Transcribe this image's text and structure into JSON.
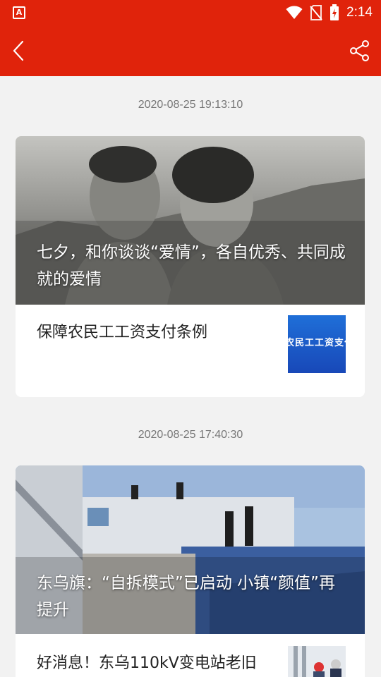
{
  "status_bar": {
    "app_icon": "A",
    "time": "2:14",
    "icons": [
      "wifi-icon",
      "no-sim-icon",
      "battery-charging-icon"
    ]
  },
  "app_bar": {
    "icons": [
      "back-arrow-icon",
      "share-icon"
    ]
  },
  "feed": [
    {
      "timestamp": "2020-08-25 19:13:10",
      "hero_title": "七夕，和你谈谈“爱情”，各自优秀、共同成就的爱情",
      "item_title": "保障农民工工资支付条例",
      "thumb_text": "农民工工资支付"
    },
    {
      "timestamp": "2020-08-25 17:40:30",
      "hero_title": "东乌旗：“自拆模式”已启动 小镇“颜值”再提升",
      "item_title": "好消息！东乌110kV变电站老旧"
    }
  ],
  "colors": {
    "brand_red": "#e0230b",
    "background": "#f2f2f2"
  }
}
